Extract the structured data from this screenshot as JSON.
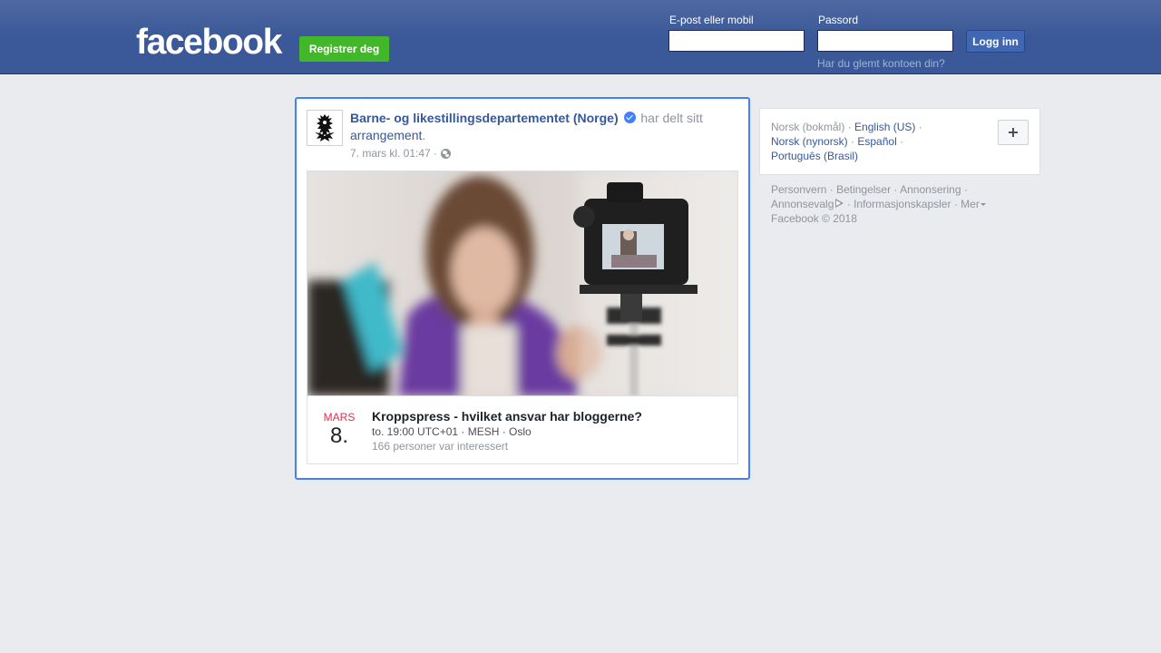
{
  "header": {
    "logo_text": "facebook",
    "register_label": "Registrer deg",
    "email_label": "E-post eller mobil",
    "email_value": "",
    "password_label": "Passord",
    "password_value": "",
    "login_label": "Logg inn",
    "forgot_label": "Har du glemt kontoen din?"
  },
  "post": {
    "page_name": "Barne- og likestillingsdepartementet (Norge)",
    "shared_text": "har delt sitt",
    "event_link_text": "arrangement",
    "event_link_suffix": ".",
    "timestamp": "7. mars kl. 01:47 ·",
    "event": {
      "month": "MARS",
      "day": "8.",
      "title": "Kroppspress - hvilket ansvar har bloggerne?",
      "details": "to. 19:00 UTC+01 · MESH · Oslo",
      "interested": "166 personer var interessert"
    }
  },
  "languages": {
    "items": [
      {
        "label": "Norsk (bokmål)"
      },
      {
        "label": "English (US)"
      },
      {
        "label": "Norsk (nynorsk)"
      },
      {
        "label": "Español"
      },
      {
        "label": "Português (Brasil)"
      }
    ],
    "separator": "·"
  },
  "footer": {
    "privacy": "Personvern",
    "terms": "Betingelser",
    "advertising": "Annonsering",
    "adchoices": "Annonsevalg",
    "cookies": "Informasjonskapsler",
    "more": "Mer",
    "copyright": "Facebook © 2018",
    "separator": "·"
  },
  "colors": {
    "brand_blue": "#3b5998",
    "register_green": "#42b72a",
    "link_blue": "#365899",
    "focus_border": "#4080ff",
    "month_red": "#f02849"
  },
  "icons": {
    "verified": "verified-badge-icon",
    "globe": "globe-icon",
    "plus": "plus-icon",
    "adchoices": "adchoices-icon",
    "caret": "caret-down-icon"
  }
}
